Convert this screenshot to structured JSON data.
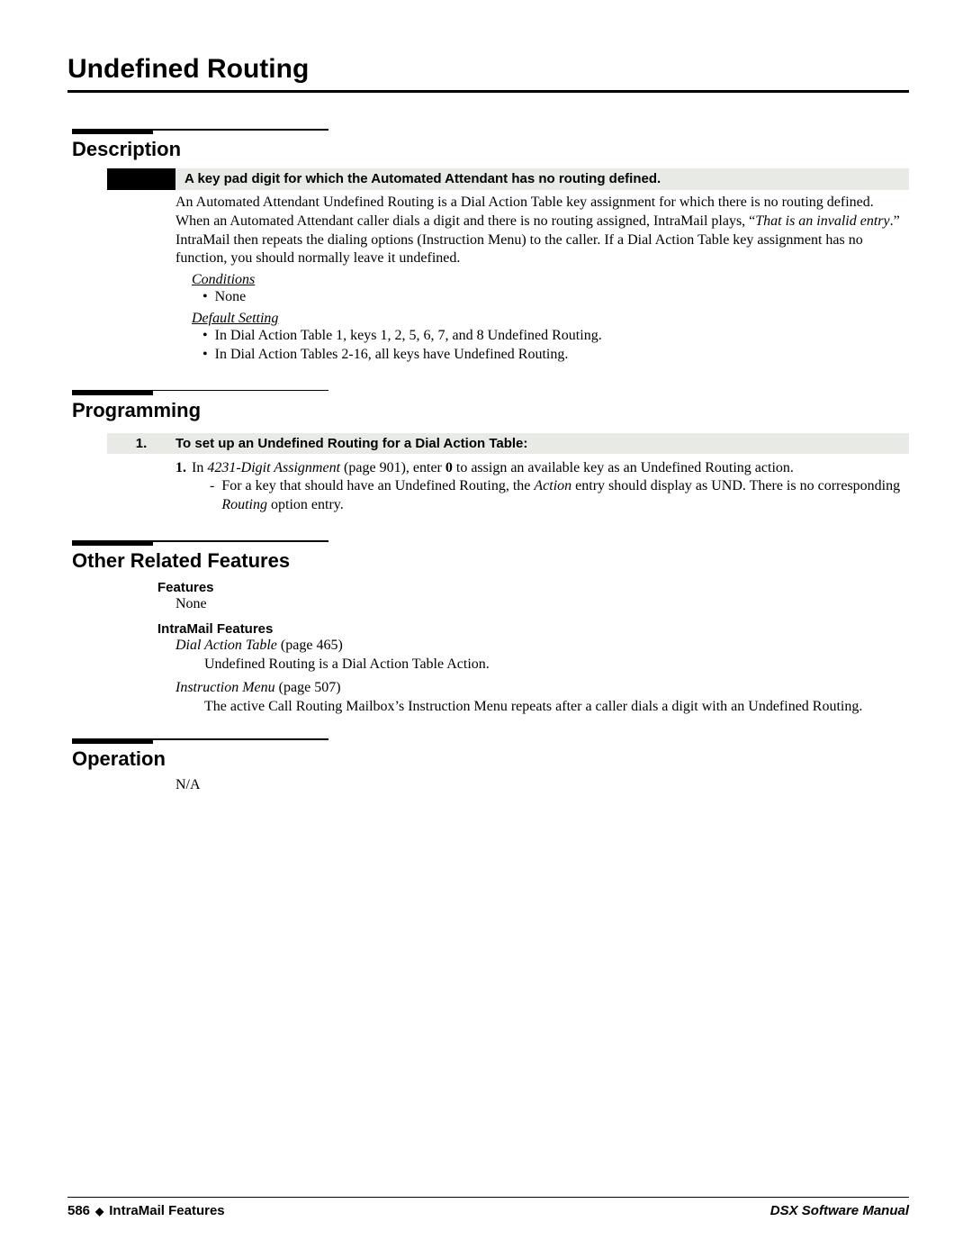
{
  "pageTitle": "Undefined Routing",
  "description": {
    "heading": "Description",
    "summary": "A key pad digit for which the Automated Attendant has no routing defined.",
    "body1": "An Automated Attendant Undefined Routing is a Dial Action Table key assignment for which there is no routing defined. When an Automated Attendant caller dials a digit and there is no routing assigned, IntraMail plays, “",
    "bodyItalic": "That is an invalid entry",
    "body2": ".” IntraMail then repeats the dialing options (Instruction Menu) to the caller. If a Dial Action Table key assignment has no function, you should normally leave it undefined.",
    "conditionsLabel": "Conditions",
    "conditionsItem": "None",
    "defaultLabel": "Default Setting",
    "defaultItem1": "In Dial Action Table 1, keys 1, 2, 5, 6, 7, and 8 Undefined Routing.",
    "defaultItem2": "In Dial Action Tables 2-16, all keys have Undefined Routing."
  },
  "programming": {
    "heading": "Programming",
    "stepNum": "1.",
    "stepTitle": "To set up an Undefined Routing for a Dial Action Table:",
    "s1n": "1.",
    "s1a": "In ",
    "s1b": "4231-Digit Assignment",
    "s1c": " (page 901), enter ",
    "s1d": "0",
    "s1e": " to assign an available key as an Undefined Routing action.",
    "sub1a": "For a key that should have an Undefined Routing, the ",
    "sub1b": "Action",
    "sub1c": " entry should display as UND. There is no corresponding ",
    "sub1d": "Routing",
    "sub1e": " option entry."
  },
  "related": {
    "heading": "Other Related Features",
    "featuresLabel": "Features",
    "featuresBody": "None",
    "intramailLabel": "IntraMail Features",
    "r1a": "Dial Action Table",
    "r1b": " (page 465)",
    "r1desc": "Undefined Routing is a Dial Action Table Action.",
    "r2a": "Instruction Menu",
    "r2b": " (page 507)",
    "r2desc": "The active Call Routing Mailbox’s Instruction Menu repeats after a caller dials a digit with an Undefined Routing."
  },
  "operation": {
    "heading": "Operation",
    "body": "N/A"
  },
  "footer": {
    "pageNum": "586",
    "section": "IntraMail Features",
    "manual": "DSX Software Manual"
  }
}
